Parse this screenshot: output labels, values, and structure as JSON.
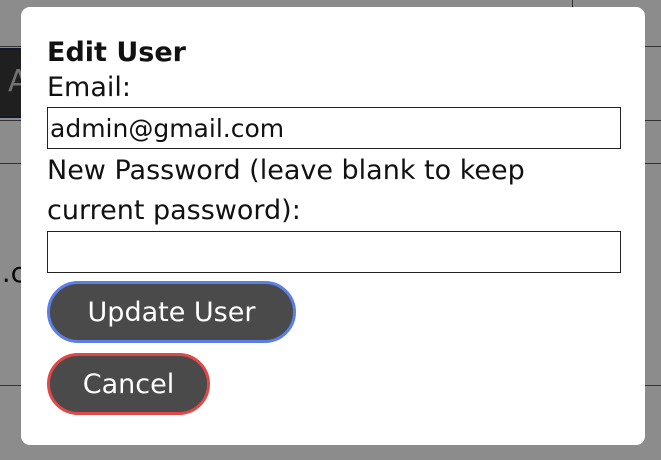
{
  "background": {
    "button_fragment": "A",
    "text_fragment": "l.c"
  },
  "modal": {
    "title": "Edit User",
    "email_label": "Email:",
    "email_value": "admin@gmail.com",
    "password_label": "New Password (leave blank to keep current password):",
    "password_value": "",
    "update_button": "Update User",
    "cancel_button": "Cancel"
  },
  "colors": {
    "overlay": "#8a8a8a",
    "modal_bg": "#ffffff",
    "button_bg": "#4a4a4a",
    "update_border": "#5b7fe6",
    "cancel_border": "#e04848"
  }
}
